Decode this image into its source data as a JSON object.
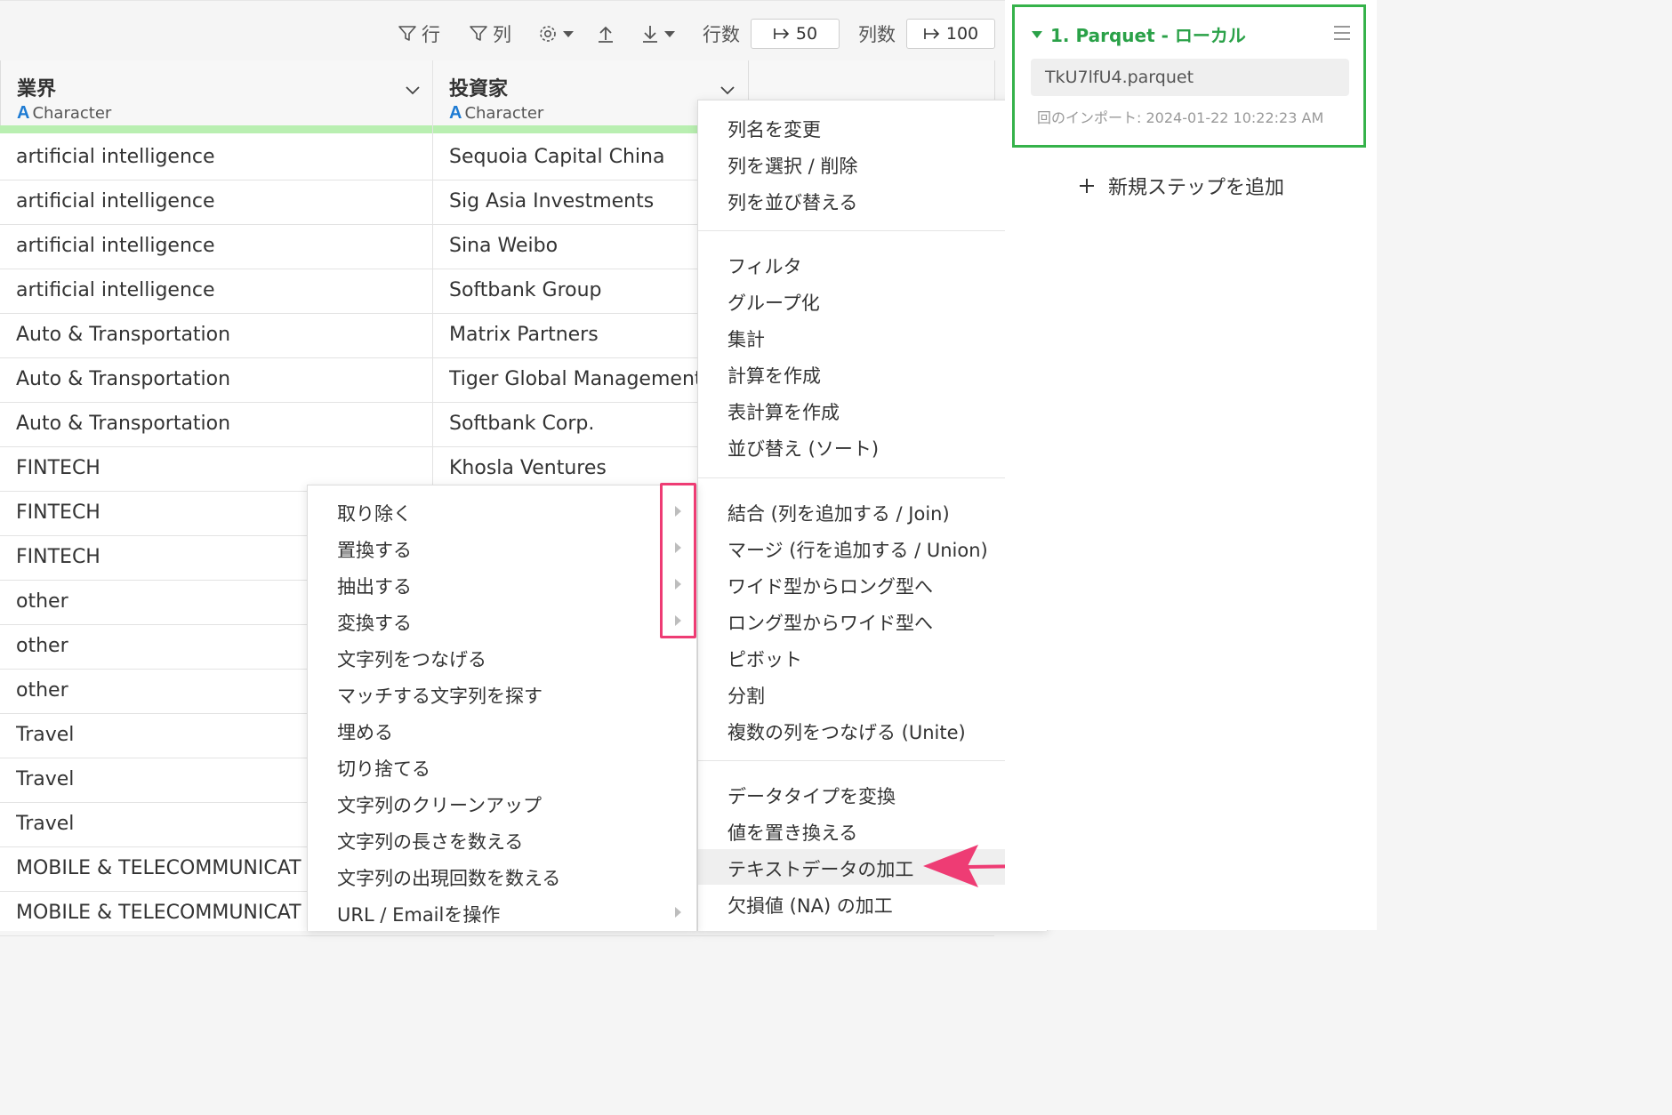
{
  "toolbar": {
    "filter_row_label": "行",
    "filter_col_label": "列",
    "rows_label": "行数",
    "rows_value": "50",
    "cols_label": "列数",
    "cols_value": "100"
  },
  "columns": [
    {
      "name": "業界",
      "type": "Character",
      "type_letter": "A"
    },
    {
      "name": "投資家",
      "type": "Character",
      "type_letter": "A"
    }
  ],
  "rows": [
    [
      "artificial intelligence",
      "Sequoia Capital China"
    ],
    [
      "artificial intelligence",
      "Sig Asia Investments"
    ],
    [
      "artificial intelligence",
      "Sina Weibo"
    ],
    [
      "artificial intelligence",
      "Softbank Group"
    ],
    [
      "Auto & Transportation",
      "Matrix Partners"
    ],
    [
      "Auto & Transportation",
      "Tiger   Global Management"
    ],
    [
      "Auto & Transportation",
      "Softbank Corp."
    ],
    [
      "FINTECH",
      "Khosla Ventures"
    ],
    [
      "FINTECH",
      ""
    ],
    [
      "FINTECH",
      ""
    ],
    [
      "other",
      ""
    ],
    [
      "other",
      ""
    ],
    [
      "other",
      ""
    ],
    [
      "Travel",
      ""
    ],
    [
      "Travel",
      ""
    ],
    [
      "Travel",
      ""
    ],
    [
      "MOBILE & TELECOMMUNICAT",
      ""
    ],
    [
      "MOBILE & TELECOMMUNICAT",
      ""
    ]
  ],
  "column_menu": {
    "items": [
      {
        "label": "列名を変更",
        "submenu": true
      },
      {
        "label": "列を選択 / 削除",
        "submenu": false
      },
      {
        "label": "列を並び替える",
        "submenu": true
      },
      {
        "label": "フィルタ",
        "submenu": true
      },
      {
        "label": "グループ化",
        "submenu": false
      },
      {
        "label": "集計",
        "submenu": false
      },
      {
        "label": "計算を作成",
        "submenu": true
      },
      {
        "label": "表計算を作成",
        "submenu": false
      },
      {
        "label": "並び替え (ソート)",
        "submenu": true
      },
      {
        "label": "結合 (列を追加する / Join)",
        "submenu": false
      },
      {
        "label": "マージ (行を追加する / Union)",
        "submenu": false
      },
      {
        "label": "ワイド型からロング型へ",
        "submenu": true
      },
      {
        "label": "ロング型からワイド型へ",
        "submenu": false
      },
      {
        "label": "ピボット",
        "submenu": false
      },
      {
        "label": "分割",
        "submenu": true
      },
      {
        "label": "複数の列をつなげる (Unite)",
        "submenu": false
      },
      {
        "label": "データタイプを変換",
        "submenu": true
      },
      {
        "label": "値を置き換える",
        "submenu": true
      },
      {
        "label": "テキストデータの加工",
        "submenu": false,
        "highlighted": true
      },
      {
        "label": "欠損値 (NA) の加工",
        "submenu": true
      }
    ]
  },
  "text_submenu": {
    "items": [
      {
        "label": "取り除く",
        "submenu": true
      },
      {
        "label": "置換する",
        "submenu": true
      },
      {
        "label": "抽出する",
        "submenu": true
      },
      {
        "label": "変換する",
        "submenu": true
      },
      {
        "label": "文字列をつなげる",
        "submenu": false
      },
      {
        "label": "マッチする文字列を探す",
        "submenu": false
      },
      {
        "label": "埋める",
        "submenu": false
      },
      {
        "label": "切り捨てる",
        "submenu": false
      },
      {
        "label": "文字列のクリーンアップ",
        "submenu": false
      },
      {
        "label": "文字列の長さを数える",
        "submenu": false
      },
      {
        "label": "文字列の出現回数を数える",
        "submenu": false
      },
      {
        "label": "URL / Emailを操作",
        "submenu": true
      }
    ]
  },
  "step": {
    "title": "1. Parquet - ローカル",
    "file": "TkU7lfU4.parquet",
    "imported": "回のインポート: 2024-01-22 10:22:23 AM"
  },
  "add_step_label": "新規ステップを追加",
  "colors": {
    "accent_green": "#2aa148",
    "highlight_pink": "#ee3c74",
    "type_blue": "#1e7bd3"
  }
}
